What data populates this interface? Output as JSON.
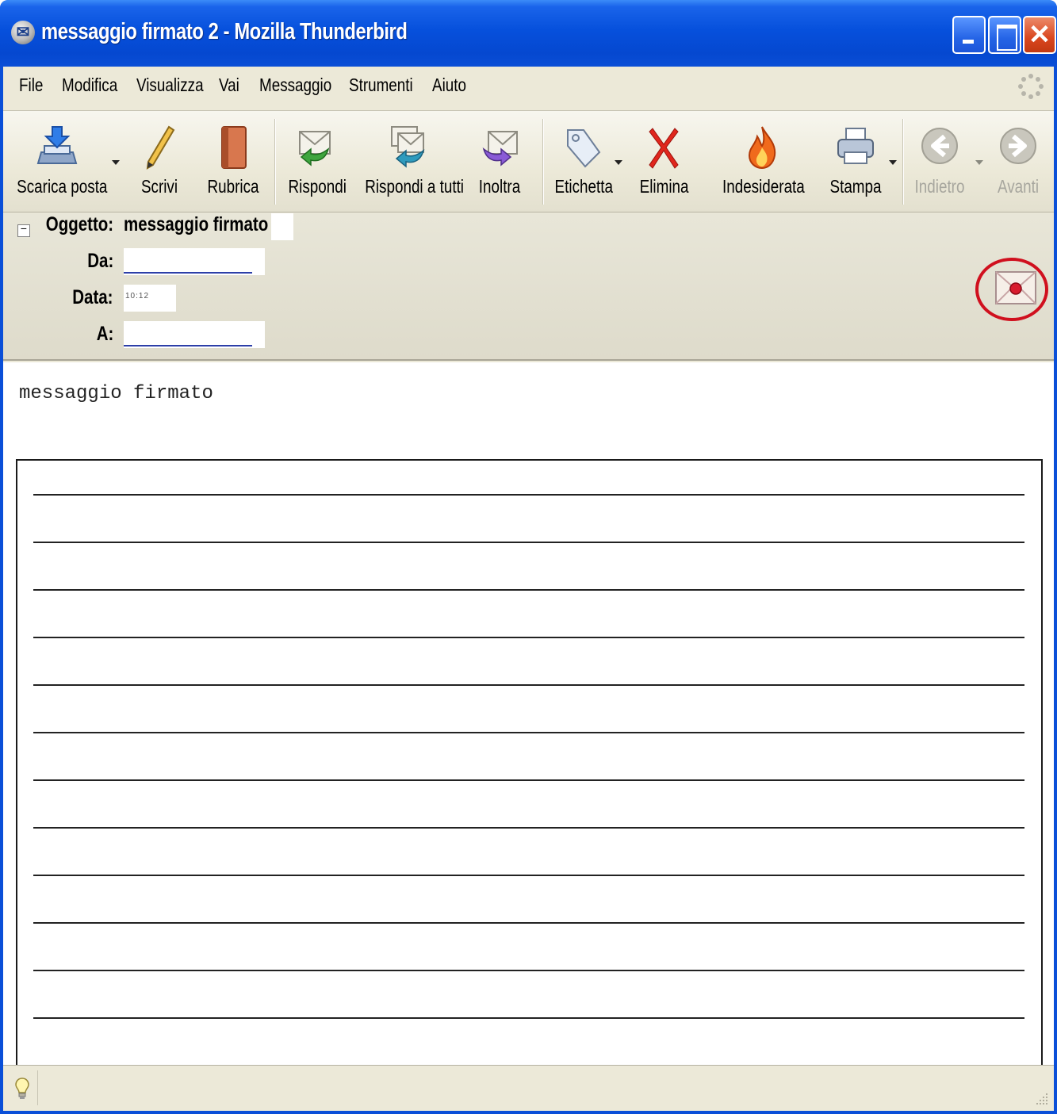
{
  "window": {
    "title": "messaggio firmato 2 - Mozilla Thunderbird",
    "app_icon": "thunderbird-icon",
    "controls": {
      "minimize": "minimize",
      "maximize": "maximize",
      "close": "✕"
    }
  },
  "menu": {
    "items": [
      "File",
      "Modifica",
      "Visualizza",
      "Vai",
      "Messaggio",
      "Strumenti",
      "Aiuto"
    ]
  },
  "toolbar": {
    "get_mail": "Scarica posta",
    "write": "Scrivi",
    "address_book": "Rubrica",
    "reply": "Rispondi",
    "reply_all": "Rispondi a tutti",
    "forward": "Inoltra",
    "tag": "Etichetta",
    "delete": "Elimina",
    "junk": "Indesiderata",
    "print": "Stampa",
    "back": "Indietro",
    "forward_nav": "Avanti"
  },
  "header": {
    "subject_label": "Oggetto:",
    "subject_value": "messaggio firmato",
    "from_label": "Da:",
    "date_label": "Data:",
    "date_value": "10:12",
    "to_label": "A:",
    "collapse_glyph": "−",
    "security_icon": "signed-message-icon",
    "highlight_color": "#d0101e"
  },
  "message": {
    "body_text": "messaggio firmato",
    "lined_rows": 12
  },
  "status": {
    "icon": "lightbulb-icon"
  }
}
